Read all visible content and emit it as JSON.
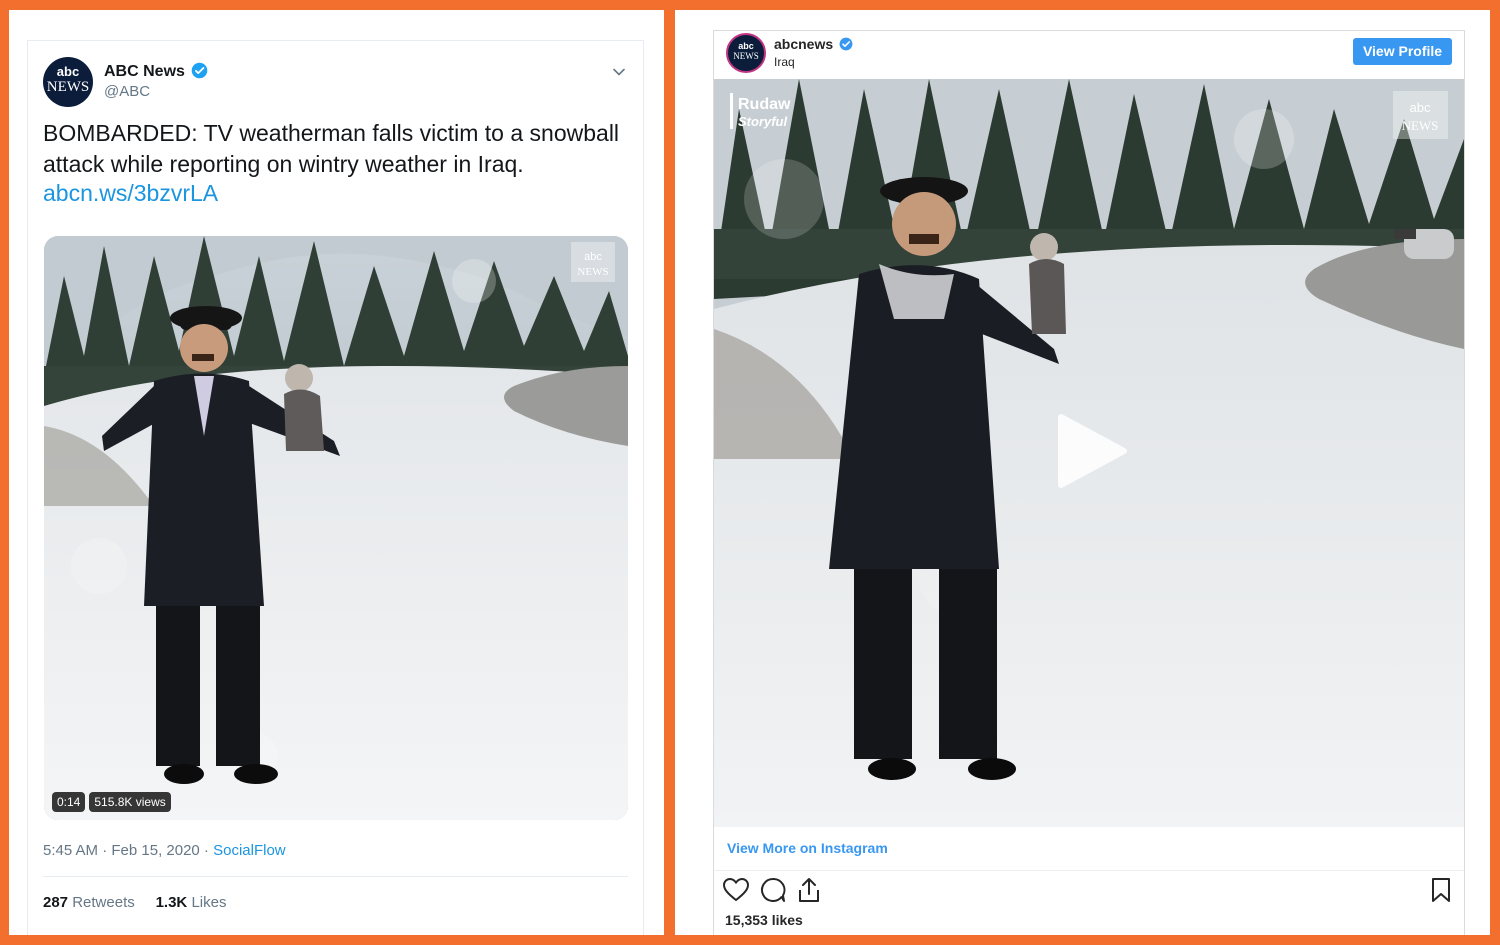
{
  "tweet": {
    "author_name": "ABC News",
    "handle": "@ABC",
    "avatar_text_top": "abc",
    "avatar_text_bottom": "NEWS",
    "text": "BOMBARDED: TV weatherman falls victim to a snowball attack while reporting on wintry weather in Iraq.",
    "link": "abcn.ws/3bzvrLA",
    "video_duration": "0:14",
    "views": "515.8K views",
    "timestamp": "5:45 AM · Feb 15, 2020 · ",
    "source": "SocialFlow",
    "retweets_count": "287",
    "retweets_label": "Retweets",
    "likes_count": "1.3K",
    "likes_label": "Likes",
    "watermark": "abc NEWS"
  },
  "instagram": {
    "username": "abcnews",
    "location": "Iraq",
    "avatar_text_top": "abc",
    "avatar_text_bottom": "NEWS",
    "view_profile_label": "View Profile",
    "credit_line1": "Rudaw",
    "credit_line2": "Storyful",
    "watermark": "abc NEWS",
    "view_more_label": "View More on Instagram",
    "likes": "15,353 likes"
  },
  "colors": {
    "frame": "#f26f2d",
    "twitter_blue": "#1b95e0",
    "instagram_blue": "#3897f0",
    "verified": "#1da1f2"
  }
}
